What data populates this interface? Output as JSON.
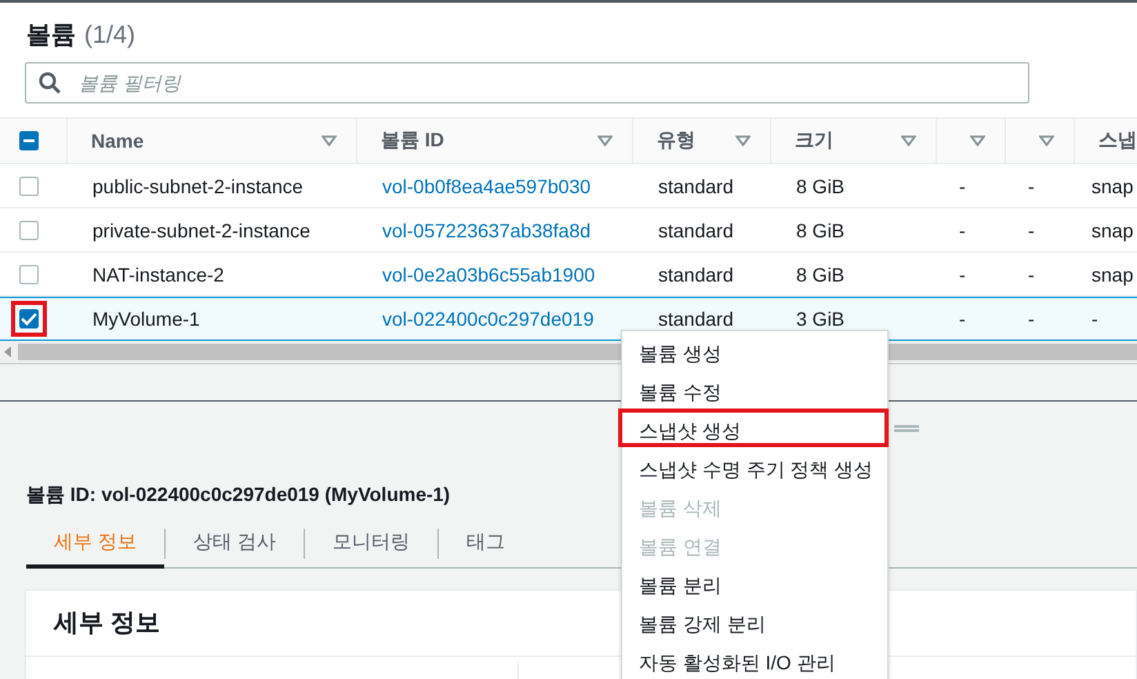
{
  "volumes": {
    "title": "볼륨",
    "count": "(1/4)",
    "search": {
      "placeholder": "볼륨 필터링"
    },
    "select_all": {
      "indeterminate": true
    },
    "columns": [
      {
        "label": "Name",
        "kind": "text",
        "sortable": true
      },
      {
        "label": "볼륨 ID",
        "kind": "link",
        "sortable": true
      },
      {
        "label": "유형",
        "kind": "text",
        "sortable": true
      },
      {
        "label": "크기",
        "kind": "text",
        "sortable": true
      },
      {
        "kind": "text",
        "sortable": true
      },
      {
        "kind": "text",
        "sortable": true
      },
      {
        "label": "스냅",
        "kind": "text",
        "sortable": false
      }
    ],
    "rows": [
      {
        "selected": false,
        "highlighted": false,
        "cells": [
          "public-subnet-2-instance",
          "vol-0b0f8ea4ae597b030",
          "standard",
          "8 GiB",
          "-",
          "-",
          "snap"
        ]
      },
      {
        "selected": false,
        "highlighted": false,
        "cells": [
          "private-subnet-2-instance",
          "vol-057223637ab38fa8d",
          "standard",
          "8 GiB",
          "-",
          "-",
          "snap"
        ]
      },
      {
        "selected": false,
        "highlighted": false,
        "cells": [
          "NAT-instance-2",
          "vol-0e2a03b6c55ab1900",
          "standard",
          "8 GiB",
          "-",
          "-",
          "snap"
        ]
      },
      {
        "selected": true,
        "highlighted": true,
        "cells": [
          "MyVolume-1",
          "vol-022400c0c297de019",
          "standard",
          "3 GiB",
          "-",
          "-",
          "-"
        ]
      }
    ]
  },
  "details": {
    "title": "볼륨 ID: vol-022400c0c297de019 (MyVolume-1)",
    "tabs": [
      {
        "label": "세부 정보",
        "selected": true
      },
      {
        "label": "상태 검사",
        "selected": false
      },
      {
        "label": "모니터링",
        "selected": false
      },
      {
        "label": "태그",
        "selected": false
      }
    ],
    "card_title": "세부 정보"
  },
  "context_menu": {
    "items": [
      {
        "label": "볼륨 생성",
        "disabled": false,
        "highlighted": false
      },
      {
        "label": "볼륨 수정",
        "disabled": false,
        "highlighted": false
      },
      {
        "label": "스냅샷 생성",
        "disabled": false,
        "highlighted": true
      },
      {
        "label": "스냅샷 수명 주기 정책 생성",
        "disabled": false,
        "highlighted": false
      },
      {
        "label": "볼륨 삭제",
        "disabled": true,
        "highlighted": false
      },
      {
        "label": "볼륨 연결",
        "disabled": true,
        "highlighted": false
      },
      {
        "label": "볼륨 분리",
        "disabled": false,
        "highlighted": false
      },
      {
        "label": "볼륨 강제 분리",
        "disabled": false,
        "highlighted": false
      },
      {
        "label": "자동 활성화된 I/O 관리",
        "disabled": false,
        "highlighted": false
      }
    ]
  }
}
